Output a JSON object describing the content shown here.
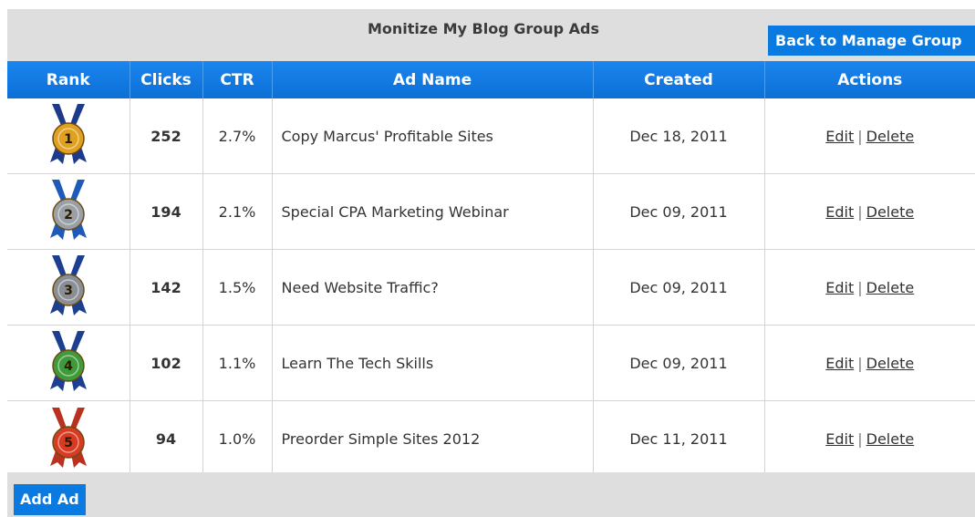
{
  "header": {
    "title": "Monitize My Blog Group Ads",
    "back_button": "Back to Manage Group"
  },
  "table": {
    "columns": {
      "rank": "Rank",
      "clicks": "Clicks",
      "ctr": "CTR",
      "ad_name": "Ad Name",
      "created": "Created",
      "actions": "Actions"
    },
    "rows": [
      {
        "rank": "1",
        "clicks": "252",
        "ctr": "2.7%",
        "ad_name": "Copy Marcus' Profitable Sites",
        "created": "Dec 18, 2011",
        "medal_color": "#e0a020",
        "ribbon_color": "#1e3a8a"
      },
      {
        "rank": "2",
        "clicks": "194",
        "ctr": "2.1%",
        "ad_name": "Special CPA Marketing Webinar",
        "created": "Dec 09, 2011",
        "medal_color": "#9aa0a6",
        "ribbon_color": "#1e5bb8"
      },
      {
        "rank": "3",
        "clicks": "142",
        "ctr": "1.5%",
        "ad_name": "Need Website Traffic?",
        "created": "Dec 09, 2011",
        "medal_color": "#8a8f96",
        "ribbon_color": "#1d3f8f"
      },
      {
        "rank": "4",
        "clicks": "102",
        "ctr": "1.1%",
        "ad_name": "Learn The Tech Skills",
        "created": "Dec 09, 2011",
        "medal_color": "#3f9a3a",
        "ribbon_color": "#1d3f8f"
      },
      {
        "rank": "5",
        "clicks": "94",
        "ctr": "1.0%",
        "ad_name": "Preorder Simple Sites 2012",
        "created": "Dec 11, 2011",
        "medal_color": "#d83a22",
        "ribbon_color": "#b8321f"
      }
    ],
    "edit_label": "Edit",
    "separator": "|",
    "delete_label": "Delete"
  },
  "footer": {
    "add_button": "Add Ad"
  },
  "colors": {
    "accent_blue": "#0a7ae0",
    "header_grey": "#dedede"
  }
}
